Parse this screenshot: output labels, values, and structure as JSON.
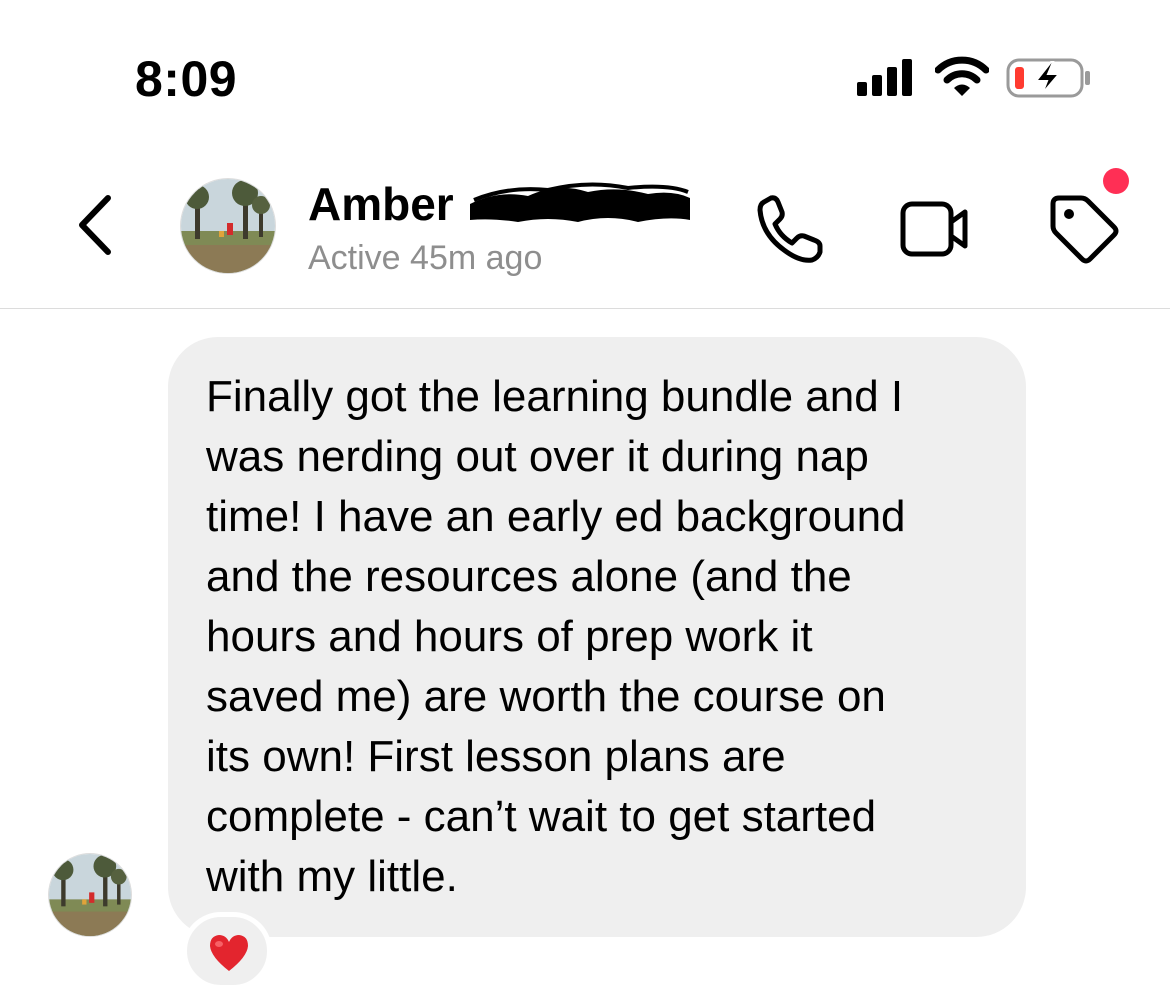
{
  "status_bar": {
    "time": "8:09",
    "icons": [
      "cellular-signal-icon",
      "wifi-icon",
      "battery-charging-icon"
    ],
    "battery_low_color": "#ff3b30"
  },
  "header": {
    "contact_name": "Amber",
    "contact_status": "Active 45m ago",
    "icons": [
      "back-chevron-icon",
      "phone-icon",
      "video-camera-icon",
      "tag-icon"
    ],
    "notification_dot_color": "#ff2f55"
  },
  "conversation": {
    "messages": [
      {
        "text": "Finally got the learning bundle and I\nwas nerding out over it during nap\ntime! I have an early ed background\nand the resources alone (and the\nhours and hours of prep work it\nsaved me) are worth the course on\nits own! First lesson plans are\ncomplete - can’t wait to get started\nwith my little.",
        "reaction": "heart-emoji-icon",
        "bubble_color": "#efefef"
      }
    ]
  }
}
